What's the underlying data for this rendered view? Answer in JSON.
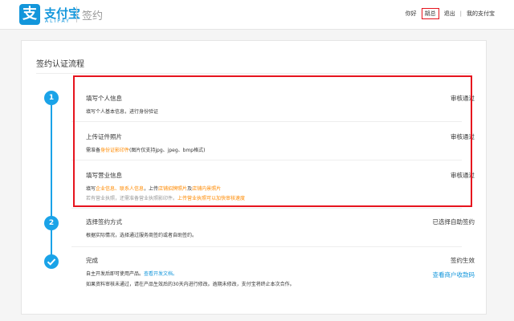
{
  "header": {
    "logo_glyph": "支",
    "brand": "支付宝",
    "brand_sub": "ALIPAY",
    "page_name": "签约",
    "nav": {
      "greeting": "你好",
      "user": "胡总",
      "logout": "退出",
      "divider": "|",
      "my_account": "我的支付宝"
    }
  },
  "card": {
    "title": "签约认证流程"
  },
  "steps": {
    "step1_number": "1",
    "step2_number": "2",
    "personal": {
      "title": "填写个人信息",
      "desc": "填写个人基本信息，进行身份验证",
      "status": "审核通过"
    },
    "id_photo": {
      "title": "上传证件照片",
      "desc_pre": "需准备",
      "desc_hl": "身份证影印件",
      "desc_post": "(图片仅支持jpg、jpeg、bmp格式)",
      "status": "审核通过"
    },
    "business": {
      "title": "填写营业信息",
      "desc_a": "填写",
      "desc_hl1": "企业信息、联系人信息",
      "desc_b": "，上传",
      "desc_hl2": "店铺招牌照片",
      "desc_c": "及",
      "desc_hl3": "店铺内景照片",
      "desc2_pre": "若有营业执照，还需准备营业执照影印件。",
      "desc2_hl": "上传营业执照可以加快审核速度",
      "status": "审核通过"
    },
    "sign_method": {
      "title": "选择签约方式",
      "desc": "根据实际情况，选择通过服务商签约或者自助签约。",
      "status": "已选择自助签约"
    },
    "done": {
      "title": "完成",
      "desc_pre": "自主开发后即可使用产品。",
      "desc_link": "查看开发文档。",
      "desc2": "如果资料审核未通过，请在产品生效后的30天内进行修改。逾期未修改，支付宝将终止本次合作。",
      "status": "签约生效",
      "status_link": "查看商户收款码"
    }
  },
  "colors": {
    "accent": "#1296db",
    "highlight": "#ff8a00",
    "annotation_red": "#e6141e"
  }
}
